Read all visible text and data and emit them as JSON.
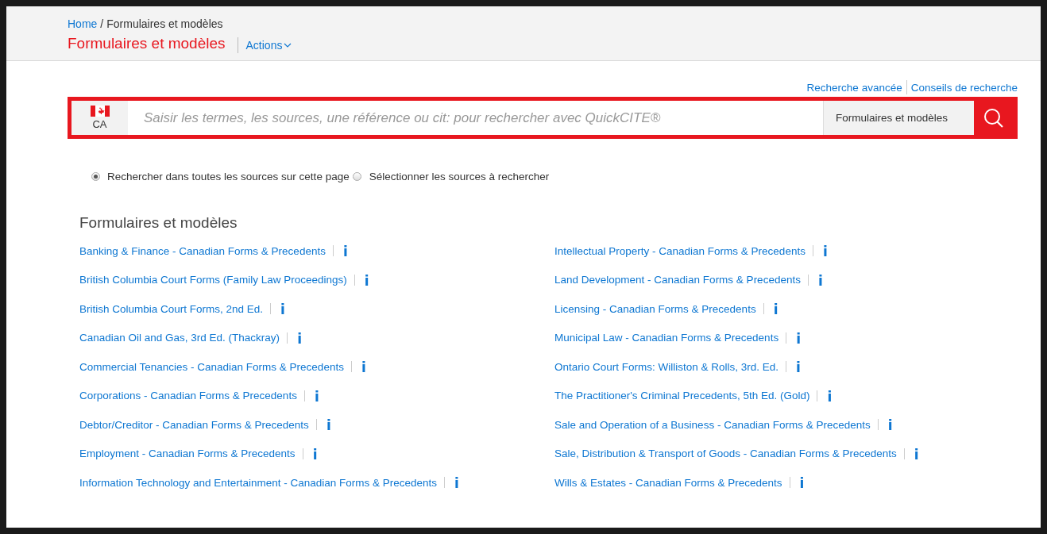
{
  "breadcrumb": {
    "home": "Home",
    "separator": "/",
    "current": "Formulaires et modèles"
  },
  "page_title": "Formulaires et modèles",
  "actions_menu": {
    "label": "Actions",
    "expanded": false
  },
  "search_links": [
    "Recherche avancée",
    "Conseils de recherche"
  ],
  "search": {
    "jurisdiction": "CA",
    "placeholder": "Saisir les termes, les sources, une référence ou cit: pour rechercher avec QuickCITE®",
    "scope": "Formulaires et modèles"
  },
  "search_options": [
    {
      "label": "Rechercher dans toutes les sources sur cette page",
      "selected": true
    },
    {
      "label": "Sélectionner les sources à rechercher",
      "selected": false
    }
  ],
  "section_title": "Formulaires et modèles",
  "sources": [
    {
      "title": "Banking & Finance - Canadian Forms & Precedents",
      "info": "i"
    },
    {
      "title": "British Columbia Court Forms (Family Law Proceedings)",
      "info": "i"
    },
    {
      "title": "British Columbia Court Forms, 2nd Ed.",
      "info": "i"
    },
    {
      "title": "Canadian Oil and Gas, 3rd Ed. (Thackray)",
      "info": "i"
    },
    {
      "title": "Commercial Tenancies - Canadian Forms & Precedents",
      "info": "i"
    },
    {
      "title": "Corporations - Canadian Forms & Precedents",
      "info": "i"
    },
    {
      "title": "Debtor/Creditor - Canadian Forms & Precedents",
      "info": "i"
    },
    {
      "title": "Employment - Canadian Forms & Precedents",
      "info": "i"
    },
    {
      "title": "Information Technology and Entertainment - Canadian Forms & Precedents",
      "info": "i"
    },
    {
      "title": "Intellectual Property - Canadian Forms & Precedents",
      "info": "i"
    },
    {
      "title": "Land Development - Canadian Forms & Precedents",
      "info": "i"
    },
    {
      "title": "Licensing - Canadian Forms & Precedents",
      "info": "i"
    },
    {
      "title": "Municipal Law - Canadian Forms & Precedents",
      "info": "i"
    },
    {
      "title": "Ontario Court Forms: Williston & Rolls, 3rd. Ed.",
      "info": "i"
    },
    {
      "title": "The Practitioner's Criminal Precedents, 5th Ed. (Gold)",
      "info": "i"
    },
    {
      "title": "Sale and Operation of a Business - Canadian Forms & Precedents",
      "info": "i"
    },
    {
      "title": "Sale, Distribution & Transport of Goods - Canadian Forms & Precedents",
      "info": "i"
    },
    {
      "title": "Wills & Estates - Canadian Forms & Precedents",
      "info": "i"
    }
  ]
}
